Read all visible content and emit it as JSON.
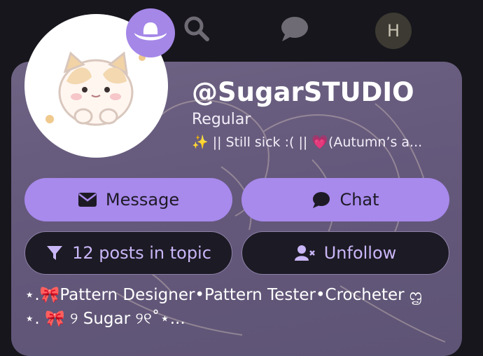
{
  "nav": {
    "avatar_letter": "H",
    "icons": [
      "search-icon",
      "chat-bubble-icon"
    ]
  },
  "profile": {
    "username": "@SugarSTUDIO",
    "title": "Regular",
    "status": "✨ || Still sick :( || 💗(Autumn’s a...",
    "flair_icon": "cowboy-hat-icon"
  },
  "buttons": {
    "message": "Message",
    "chat": "Chat",
    "topic": "12 posts in topic",
    "unfollow": "Unfollow"
  },
  "bio": "⋆.🎀Pattern Designer•Pattern Tester•Crocheter ᦗ\n⋆. 🎀 ୨ Sugar ୨୧˚⋆..."
}
